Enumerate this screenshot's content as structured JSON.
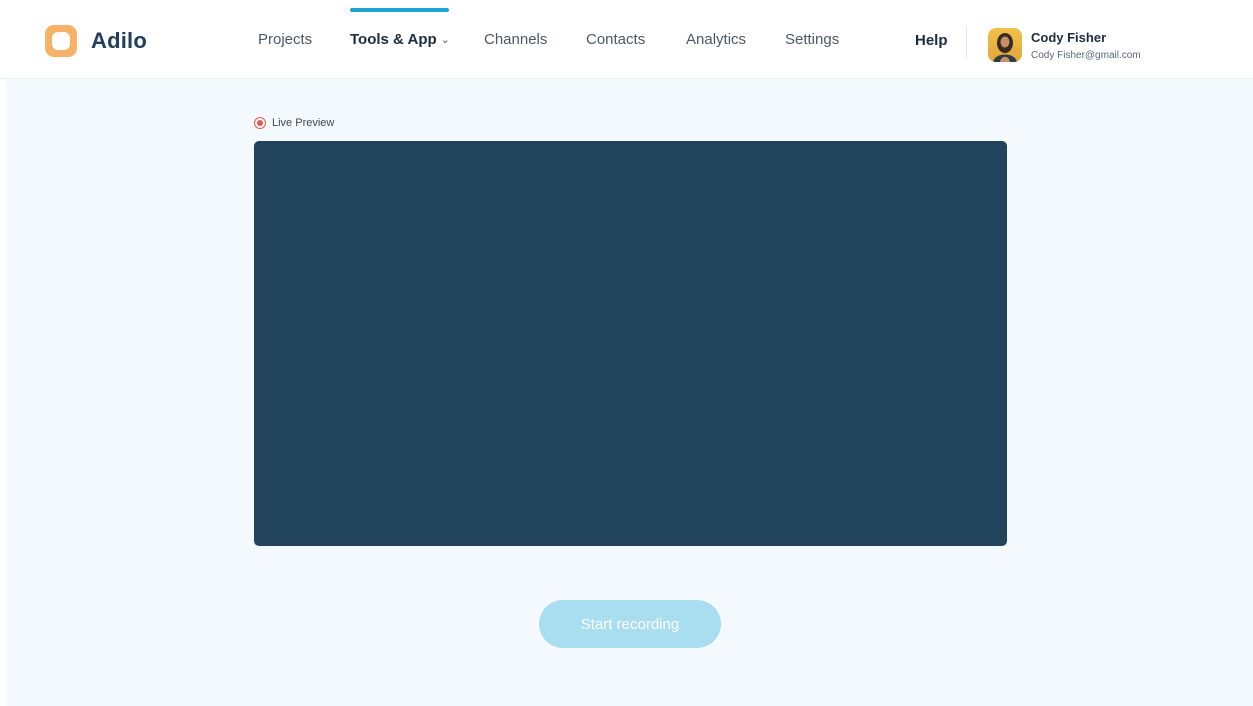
{
  "app": {
    "name": "Adilo",
    "logo_icon": "rounded-square-logo",
    "brand_color": "#f7b267"
  },
  "nav": {
    "items": [
      {
        "label": "Projects",
        "active": false
      },
      {
        "label": "Tools & App",
        "active": true,
        "has_dropdown": true
      },
      {
        "label": "Channels",
        "active": false
      },
      {
        "label": "Contacts",
        "active": false
      },
      {
        "label": "Analytics",
        "active": false
      },
      {
        "label": "Settings",
        "active": false
      }
    ],
    "active_indicator_color": "#1ea4d2",
    "dropdown_icon": "chevron-down-icon"
  },
  "header": {
    "help_label": "Help"
  },
  "user": {
    "name": "Cody Fisher",
    "email": "Cody Fisher@gmail.com",
    "avatar_icon": "avatar-photo"
  },
  "preview": {
    "live_label": "Live Preview",
    "live_icon": "record-dot-icon",
    "live_color": "#e25b4f",
    "screen_color": "#22435c"
  },
  "actions": {
    "start_recording_label": "Start recording",
    "button_color": "#a8def0"
  }
}
